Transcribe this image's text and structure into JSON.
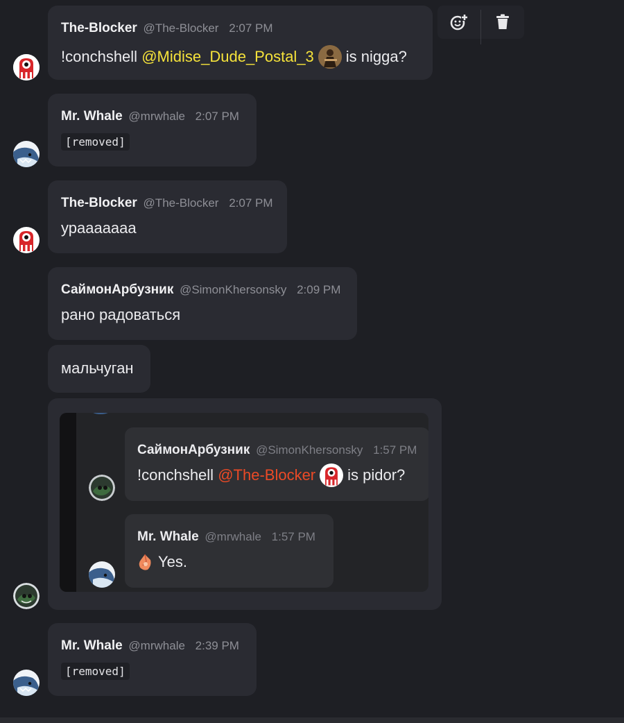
{
  "toolbar": {
    "react_icon": "add-reaction-icon",
    "delete_icon": "trash-icon"
  },
  "messages": [
    {
      "username": "The-Blocker",
      "handle": "@The-Blocker",
      "time": "2:07 PM",
      "text_prefix": "!conchshell",
      "mention": "@Midise_Dude_Postal_3",
      "text_suffix": "is nigga?"
    },
    {
      "username": "Mr. Whale",
      "handle": "@mrwhale",
      "time": "2:07 PM",
      "code": "[removed]"
    },
    {
      "username": "The-Blocker",
      "handle": "@The-Blocker",
      "time": "2:07 PM",
      "text": "урааааааа"
    },
    {
      "username": "СаймонАрбузник",
      "handle": "@SimonKhersonsky",
      "time": "2:09 PM",
      "text": "рано радоваться"
    },
    {
      "text": "мальчуган"
    },
    {
      "username": "Mr. Whale",
      "handle": "@mrwhale",
      "time": "2:39 PM",
      "code": "[removed]"
    }
  ],
  "embed": {
    "messages": [
      {
        "username": "СаймонАрбузник",
        "handle": "@SimonKhersonsky",
        "time": "1:57 PM",
        "text_prefix": "!conchshell",
        "mention": "@The-Blocker",
        "text_suffix": "is pidor?"
      },
      {
        "username": "Mr. Whale",
        "handle": "@mrwhale",
        "time": "1:57 PM",
        "text": "Yes."
      }
    ]
  },
  "colors": {
    "background": "#1e1f24",
    "bubble": "#2a2b32",
    "mention_yellow": "#f6e33b",
    "mention_red": "#ec4a26"
  }
}
